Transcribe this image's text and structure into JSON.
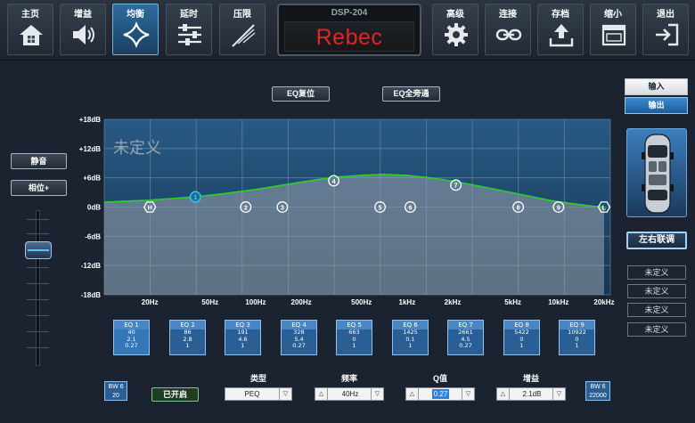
{
  "nav": [
    {
      "label": "主页",
      "icon": "home-icon"
    },
    {
      "label": "增益",
      "icon": "speaker-icon"
    },
    {
      "label": "均衡",
      "icon": "eq-curve-icon"
    },
    {
      "label": "延时",
      "icon": "sliders-icon"
    },
    {
      "label": "压限",
      "icon": "limiter-icon"
    },
    {
      "label": "高级",
      "icon": "gear-icon"
    },
    {
      "label": "连接",
      "icon": "link-icon"
    },
    {
      "label": "存档",
      "icon": "upload-icon"
    },
    {
      "label": "缩小",
      "icon": "window-icon"
    },
    {
      "label": "退出",
      "icon": "exit-icon"
    }
  ],
  "nav_active": "均衡",
  "brand": {
    "model": "DSP-204",
    "logo": "Rebec"
  },
  "eq_actions": {
    "reset": "EQ复位",
    "bypass": "EQ全旁通"
  },
  "left": {
    "mute": "静音",
    "phase": "相位+"
  },
  "preset_overlay": "未定义",
  "chart_data": {
    "type": "line",
    "yticks": [
      "+18dB",
      "+12dB",
      "+6dB",
      "0dB",
      "-6dB",
      "-12dB",
      "-18dB"
    ],
    "ylim": [
      -18,
      18
    ],
    "xlim": [
      20,
      20000
    ],
    "xscale": "log",
    "xticks": [
      {
        "label": "20Hz",
        "freq": 20
      },
      {
        "label": "50Hz",
        "freq": 50
      },
      {
        "label": "100Hz",
        "freq": 100
      },
      {
        "label": "200Hz",
        "freq": 200
      },
      {
        "label": "500Hz",
        "freq": 500
      },
      {
        "label": "1kHz",
        "freq": 1000
      },
      {
        "label": "2kHz",
        "freq": 2000
      },
      {
        "label": "5kHz",
        "freq": 5000
      },
      {
        "label": "10kHz",
        "freq": 10000
      },
      {
        "label": "20kHz",
        "freq": 20000
      }
    ],
    "curve": [
      {
        "f": 10,
        "db": 1.0
      },
      {
        "f": 20,
        "db": 1.4
      },
      {
        "f": 40,
        "db": 2.1
      },
      {
        "f": 60,
        "db": 2.7
      },
      {
        "f": 100,
        "db": 3.6
      },
      {
        "f": 150,
        "db": 4.5
      },
      {
        "f": 250,
        "db": 5.6
      },
      {
        "f": 330,
        "db": 6.1
      },
      {
        "f": 500,
        "db": 6.5
      },
      {
        "f": 700,
        "db": 6.7
      },
      {
        "f": 1000,
        "db": 6.5
      },
      {
        "f": 1500,
        "db": 5.9
      },
      {
        "f": 2100,
        "db": 5.2
      },
      {
        "f": 3000,
        "db": 4.3
      },
      {
        "f": 4500,
        "db": 3.2
      },
      {
        "f": 6500,
        "db": 2.2
      },
      {
        "f": 9000,
        "db": 1.3
      },
      {
        "f": 13000,
        "db": 0.6
      },
      {
        "f": 17000,
        "db": 0.15
      },
      {
        "f": 20000,
        "db": 0.0
      }
    ],
    "markers": [
      {
        "label": "H",
        "freq": 20,
        "db": 0,
        "shape": "hex"
      },
      {
        "label": "1",
        "freq": 40,
        "db": 2.1,
        "shape": "circle",
        "selected": true
      },
      {
        "label": "2",
        "freq": 86,
        "db": 0,
        "shape": "circle"
      },
      {
        "label": "3",
        "freq": 150,
        "db": 0,
        "shape": "circle"
      },
      {
        "label": "4",
        "freq": 328,
        "db": 5.4,
        "shape": "circle"
      },
      {
        "label": "5",
        "freq": 663,
        "db": 0,
        "shape": "circle"
      },
      {
        "label": "6",
        "freq": 1050,
        "db": 0,
        "shape": "circle"
      },
      {
        "label": "7",
        "freq": 2100,
        "db": 4.5,
        "shape": "circle"
      },
      {
        "label": "8",
        "freq": 5422,
        "db": 0,
        "shape": "circle"
      },
      {
        "label": "9",
        "freq": 10000,
        "db": 0,
        "shape": "circle"
      },
      {
        "label": "L",
        "freq": 20000,
        "db": 0,
        "shape": "hex"
      }
    ],
    "colors": {
      "curve": "#2bd12b",
      "fill": "#9ba3ad",
      "grid": "#6f8daa",
      "bg": "#1f4a6e",
      "marker": "#ffffff",
      "marker_selected": "#3ec7ff"
    }
  },
  "bands": [
    {
      "name": "EQ 1",
      "freq": "40",
      "gain": "2.1",
      "q": "0.27"
    },
    {
      "name": "EQ 2",
      "freq": "86",
      "gain": "2.8",
      "q": "1"
    },
    {
      "name": "EQ 3",
      "freq": "191",
      "gain": "4.6",
      "q": "1"
    },
    {
      "name": "EQ 4",
      "freq": "328",
      "gain": "5.4",
      "q": "0.27"
    },
    {
      "name": "EQ 5",
      "freq": "663",
      "gain": "0",
      "q": "1"
    },
    {
      "name": "EQ 6",
      "freq": "1425",
      "gain": "0.1",
      "q": "1"
    },
    {
      "name": "EQ 7",
      "freq": "2661",
      "gain": "4.5",
      "q": "0.27"
    },
    {
      "name": "EQ 8",
      "freq": "5422",
      "gain": "0",
      "q": "1"
    },
    {
      "name": "EQ 9",
      "freq": "10922",
      "gain": "0",
      "q": "1"
    }
  ],
  "controls": {
    "bw_left": {
      "label": "BW 6",
      "value": "20"
    },
    "enabled": "已开启",
    "type": {
      "label": "类型",
      "value": "PEQ"
    },
    "freq": {
      "label": "频率",
      "value": "40Hz"
    },
    "q": {
      "label": "Q值",
      "value": "0.27"
    },
    "gain": {
      "label": "增益",
      "value": "2.1dB"
    },
    "bw_right": {
      "label": "BW 6",
      "value": "22000"
    }
  },
  "io": {
    "input": "输入",
    "output": "输出",
    "active": "输出"
  },
  "link": "左右联调",
  "presets": [
    "未定义",
    "未定义",
    "未定义",
    "未定义"
  ]
}
